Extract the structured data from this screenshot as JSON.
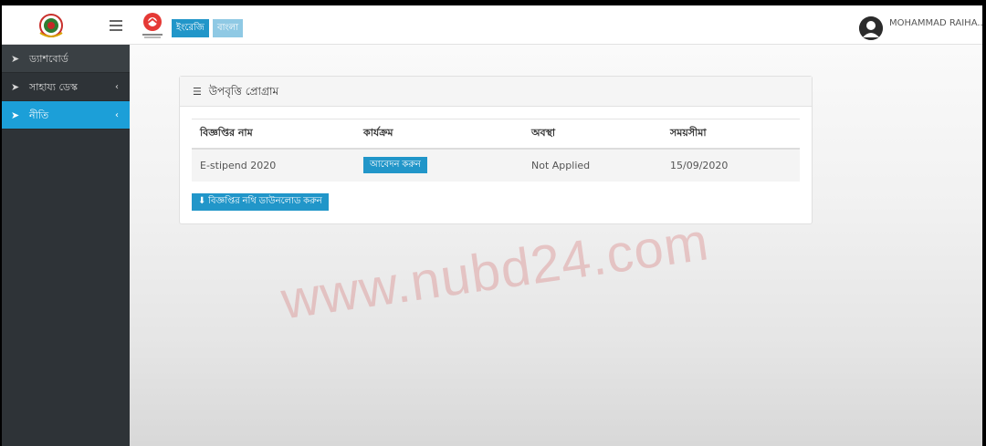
{
  "header": {
    "lang_en": "ইংরেজি",
    "lang_bn": "বাংলা",
    "user_name": "MOHAMMAD RAIHA...",
    "icons": {
      "logo": "bangladesh-gov-seal",
      "menu": "hamburger-icon",
      "brand": "brand-logo",
      "avatar": "user-avatar"
    }
  },
  "sidebar": {
    "items": [
      {
        "label": "ড্যাশবোর্ড",
        "icon": "navigation-arrow-icon",
        "has_chevron": false
      },
      {
        "label": "সাহায্য ডেস্ক",
        "icon": "navigation-arrow-icon",
        "has_chevron": true
      },
      {
        "label": "নীতি",
        "icon": "navigation-arrow-icon",
        "has_chevron": true,
        "active": true
      }
    ],
    "chevron": "‹"
  },
  "panel": {
    "title": "উপবৃত্তি প্রোগ্রাম",
    "columns": [
      "বিজ্ঞপ্তির নাম",
      "কার্যক্রম",
      "অবস্থা",
      "সময়সীমা"
    ],
    "rows": [
      {
        "name": "E-stipend 2020",
        "action": "আবেদন করুন",
        "status": "Not Applied",
        "deadline": "15/09/2020"
      }
    ],
    "download_label": "বিজ্ঞপ্তির নথি ডাউনলোড করুন"
  },
  "watermark": "www.nubd24.com",
  "colors": {
    "accent": "#2196c9",
    "sidebar_bg": "#2e3337",
    "active_item": "#1c9fd8"
  }
}
